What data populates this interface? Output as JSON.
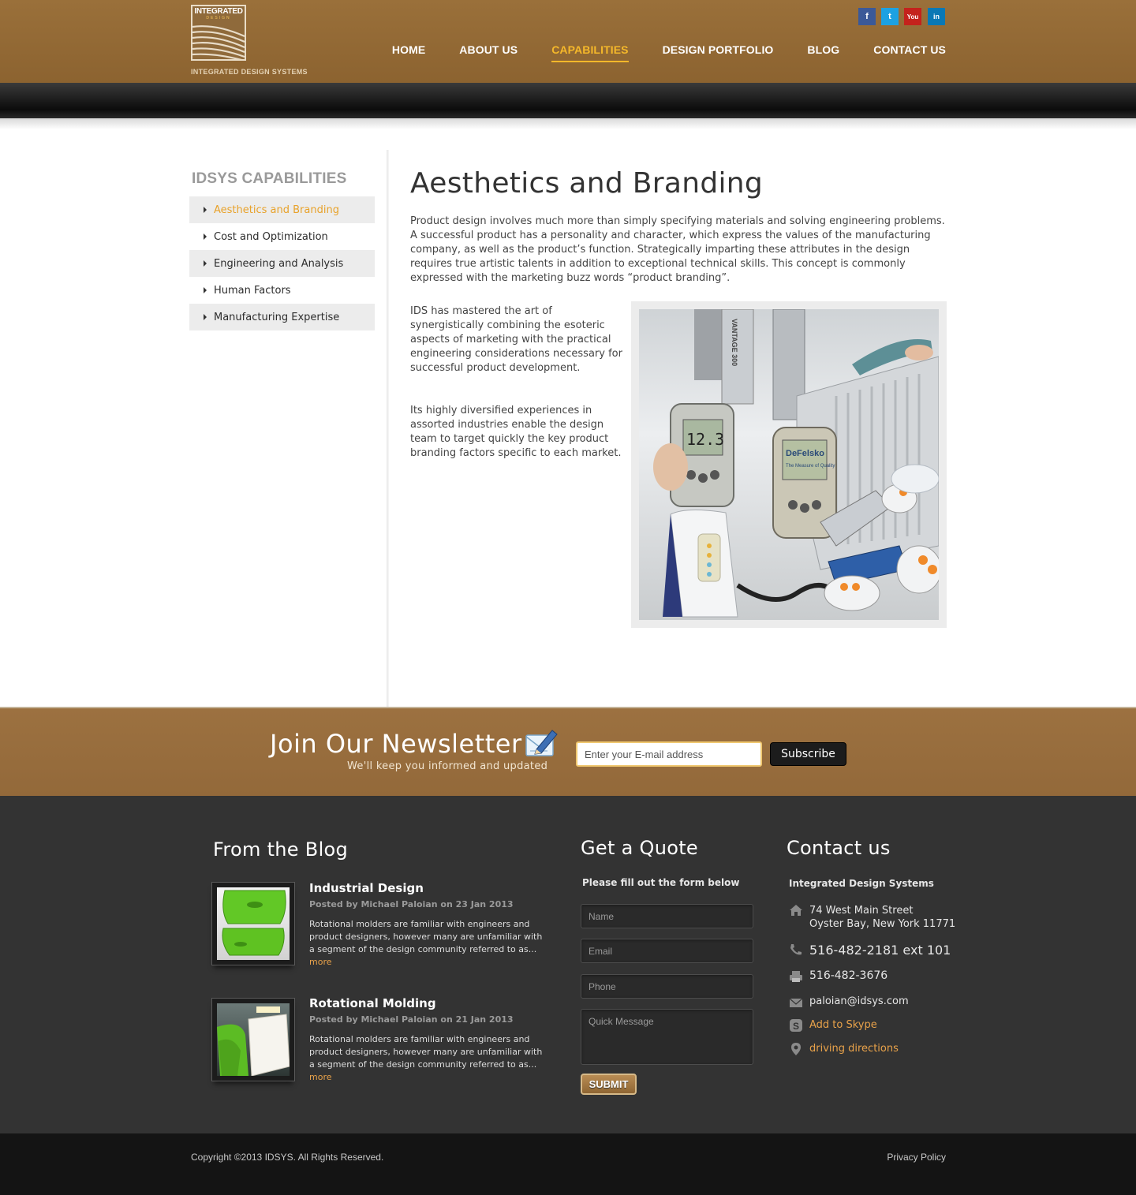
{
  "header": {
    "logo_word": "INTEGRATED",
    "logo_sub": "DESIGN",
    "logo_caption": "INTEGRATED DESIGN SYSTEMS",
    "social": [
      {
        "icon": "facebook-icon",
        "glyph": "f"
      },
      {
        "icon": "twitter-icon",
        "glyph": "t"
      },
      {
        "icon": "youtube-icon",
        "glyph": "You"
      },
      {
        "icon": "linkedin-icon",
        "glyph": "in"
      }
    ],
    "nav": [
      {
        "label": "HOME",
        "active": false
      },
      {
        "label": "ABOUT US",
        "active": false
      },
      {
        "label": "CAPABILITIES",
        "active": true
      },
      {
        "label": "DESIGN PORTFOLIO",
        "active": false
      },
      {
        "label": "BLOG",
        "active": false
      },
      {
        "label": "CONTACT US",
        "active": false
      }
    ],
    "accent_color": "#f5b82a",
    "brand_color": "#936a38"
  },
  "sidebar": {
    "title": "IDSYS CAPABILITIES",
    "items": [
      {
        "label": "Aesthetics and Branding",
        "active": true
      },
      {
        "label": "Cost and Optimization",
        "active": false
      },
      {
        "label": "Engineering and Analysis",
        "active": false
      },
      {
        "label": "Human Factors",
        "active": false
      },
      {
        "label": "Manufacturing Expertise",
        "active": false
      }
    ]
  },
  "main": {
    "title": "Aesthetics and Branding",
    "intro": "Product design involves much more than simply specifying materials and solving engineering problems. A successful product has a personality and character, which express the values of the manufacturing company, as well as the product’s function. Strategically imparting these attributes in the design requires true artistic talents in addition to exceptional technical skills. This concept is commonly expressed with the marketing buzz words “product branding”.",
    "paragraph_1": "IDS has mastered the art of synergistically combining the esoteric aspects of marketing with the practical engineering considerations necessary for successful product development.",
    "paragraph_2": "Its highly diversified experiences in assorted industries enable the design team to target quickly the key product branding factors specific to each market.",
    "photo": {
      "gauge_reading": "12.3",
      "brand_text": "DeFelsko",
      "brand_tagline": "The Measure of Quality",
      "machine_label": "VANTAGE 300"
    }
  },
  "newsletter": {
    "title": "Join Our Newsletter",
    "subtitle": "We'll keep you informed and updated",
    "email_placeholder": "Enter your E-mail address",
    "button_label": "Subscribe"
  },
  "blog": {
    "heading": "From the Blog",
    "posts": [
      {
        "title": "Industrial Design",
        "meta": "Posted by Michael Paloian on 23 Jan 2013",
        "excerpt": "Rotational molders are familiar with engineers and product designers, however many are unfamiliar with a segment of the design community referred to as...",
        "more": "more"
      },
      {
        "title": "Rotational Molding",
        "meta": "Posted by Michael Paloian on 21 Jan 2013",
        "excerpt": "Rotational molders are familiar with engineers and product designers, however many are unfamiliar with a segment of the design community referred to as...",
        "more": "more"
      }
    ]
  },
  "quote": {
    "heading": "Get a Quote",
    "intro": "Please fill out the form below",
    "name_placeholder": "Name",
    "email_placeholder": "Email",
    "phone_placeholder": "Phone",
    "message_placeholder": "Quick Message",
    "submit_label": "SUBMIT"
  },
  "contact": {
    "heading": "Contact us",
    "company": "Integrated Design Systems",
    "address_line1": "74 West Main Street",
    "address_line2": "Oyster Bay, New York 11771",
    "phone": "516-482-2181  ext 101",
    "fax": "516-482-3676",
    "email": "paloian@idsys.com",
    "skype": "Add to Skype",
    "directions": "driving directions"
  },
  "bottom": {
    "copyright": "Copyright ©2013 IDSYS. All Rights Reserved.",
    "privacy": "Privacy Policy"
  }
}
